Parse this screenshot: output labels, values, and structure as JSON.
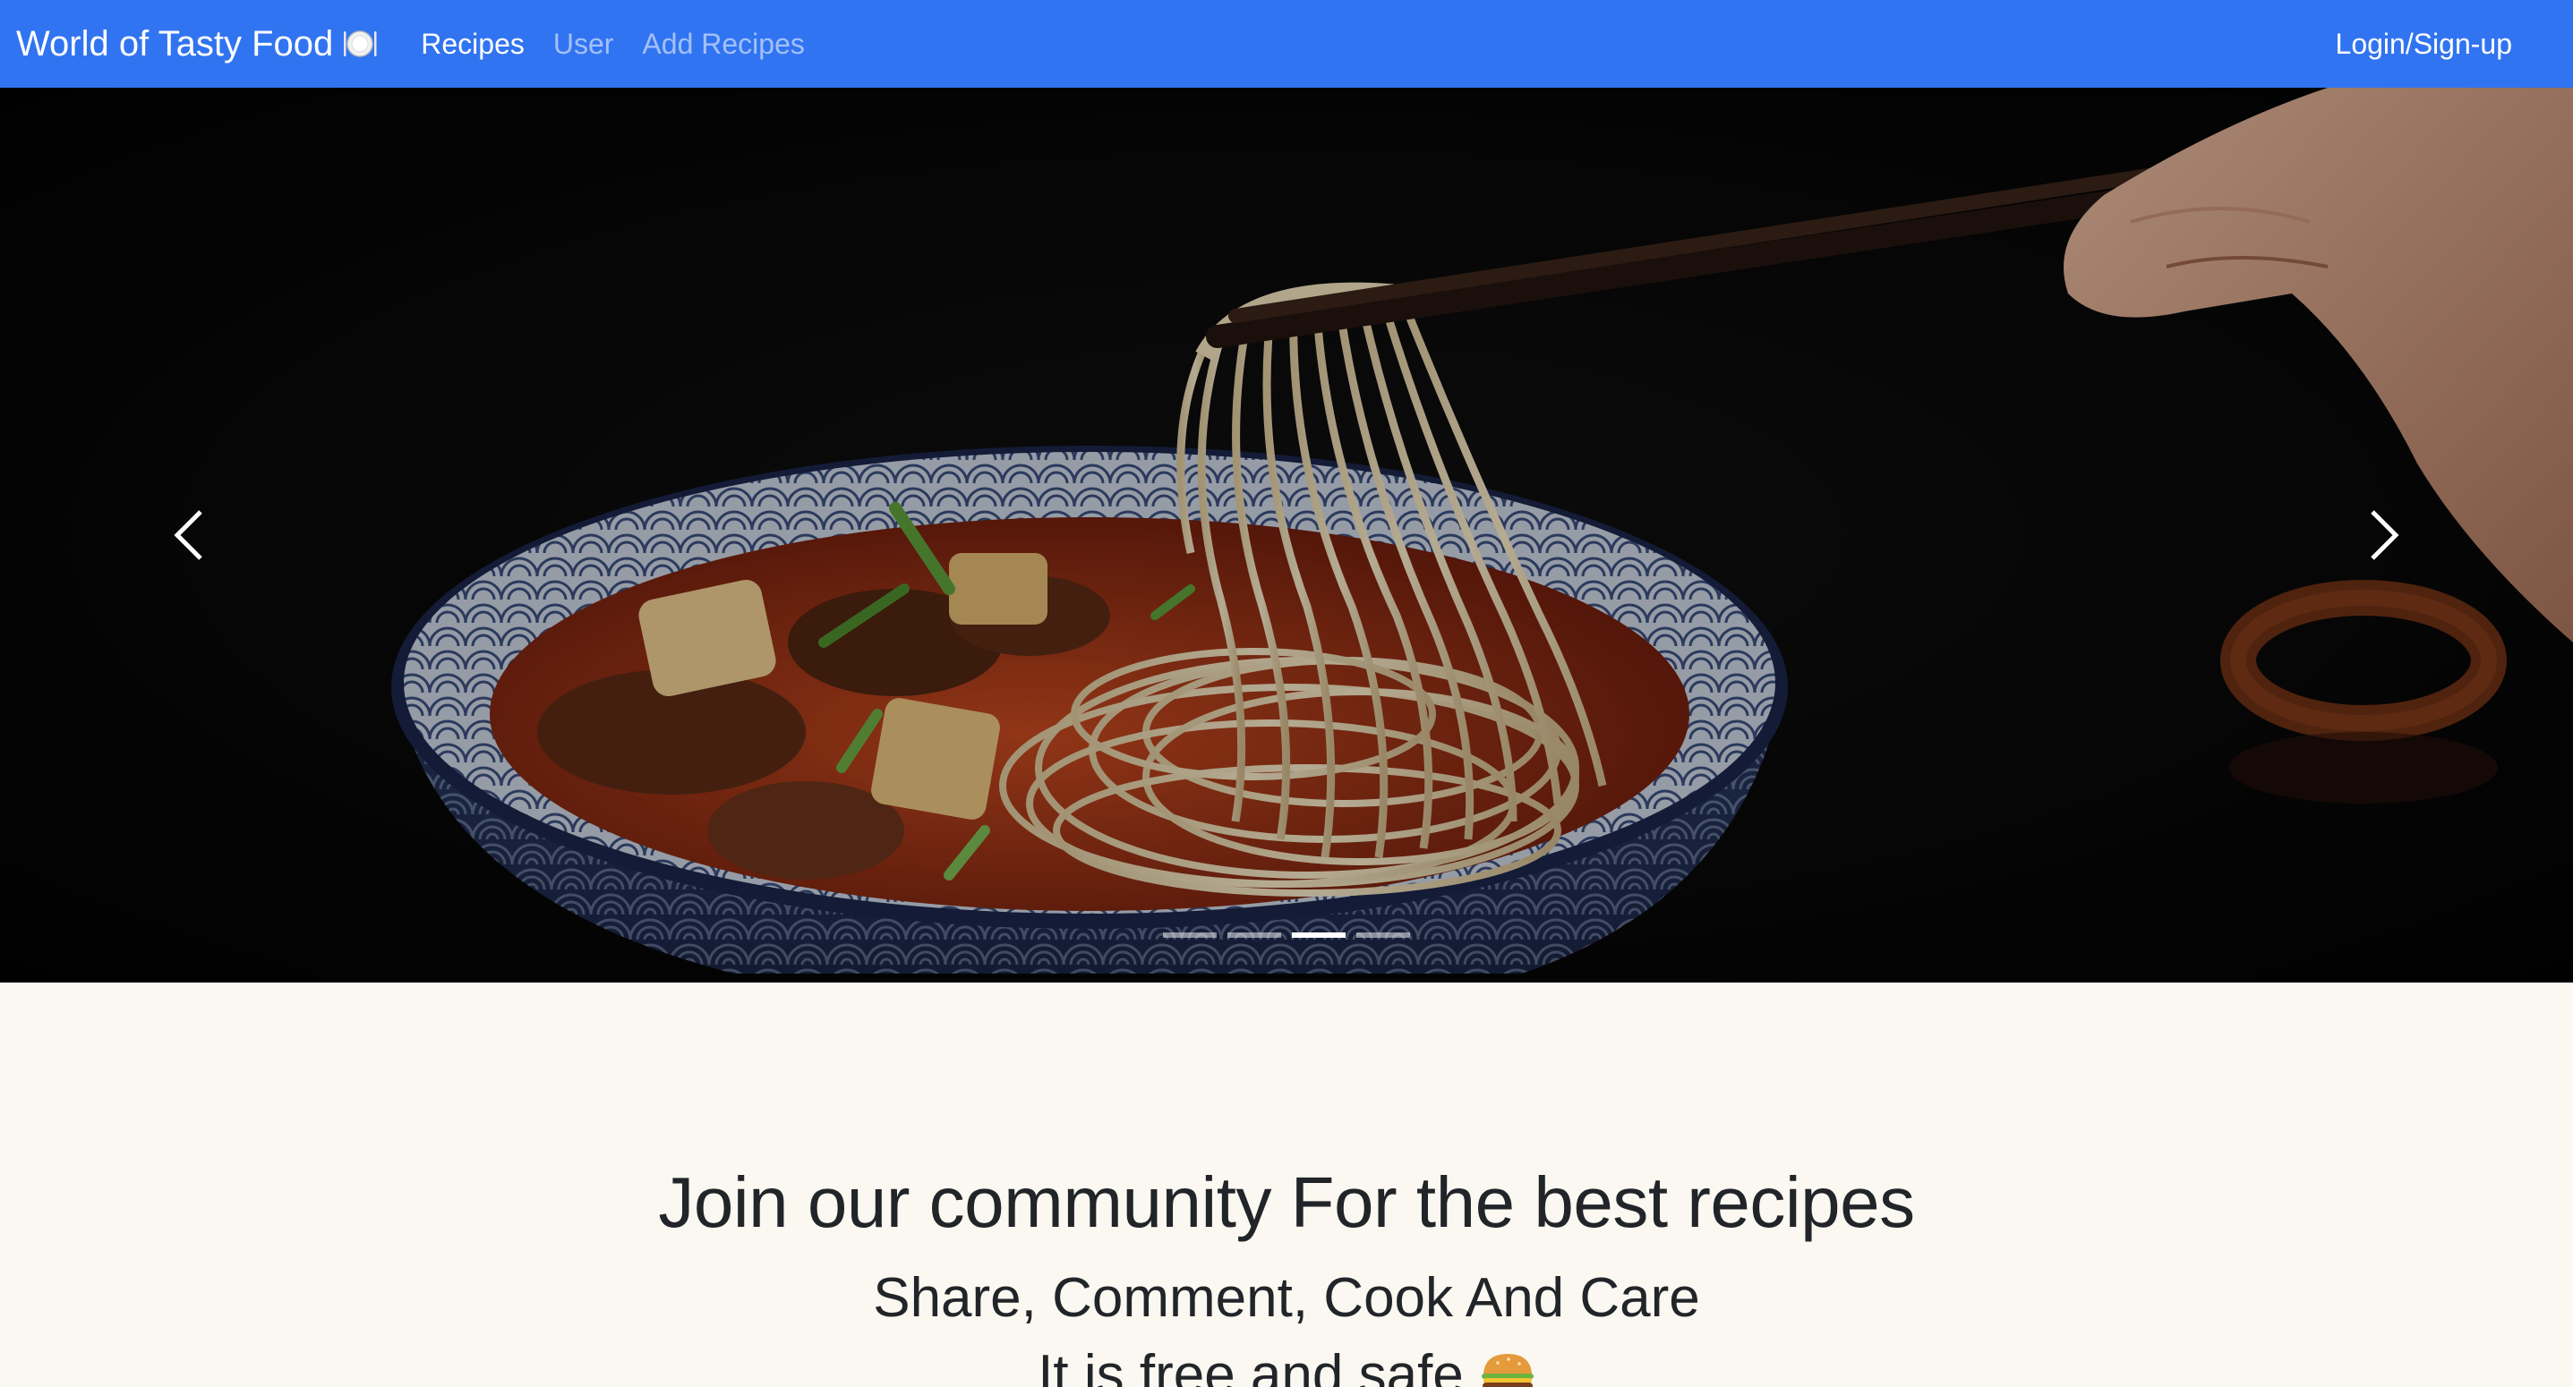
{
  "navbar": {
    "brand": "World of Tasty Food",
    "brand_icon": "plate-cutlery-icon",
    "links": [
      {
        "label": "Recipes",
        "active": true
      },
      {
        "label": "User",
        "active": false
      },
      {
        "label": "Add Recipes",
        "active": false
      }
    ],
    "login": "Login/Sign-up",
    "color": "#3174f1"
  },
  "carousel": {
    "slide_image": "noodle-bowl-with-chopsticks",
    "prev_icon": "chevron-left-icon",
    "next_icon": "chevron-right-icon",
    "slide_count": 4,
    "active_index": 2
  },
  "hero": {
    "title": "Join our community For the best recipes",
    "subtitle": "Share, Comment, Cook And Care",
    "tagline": "It is free and safe",
    "tagline_icon": "burger-icon"
  }
}
